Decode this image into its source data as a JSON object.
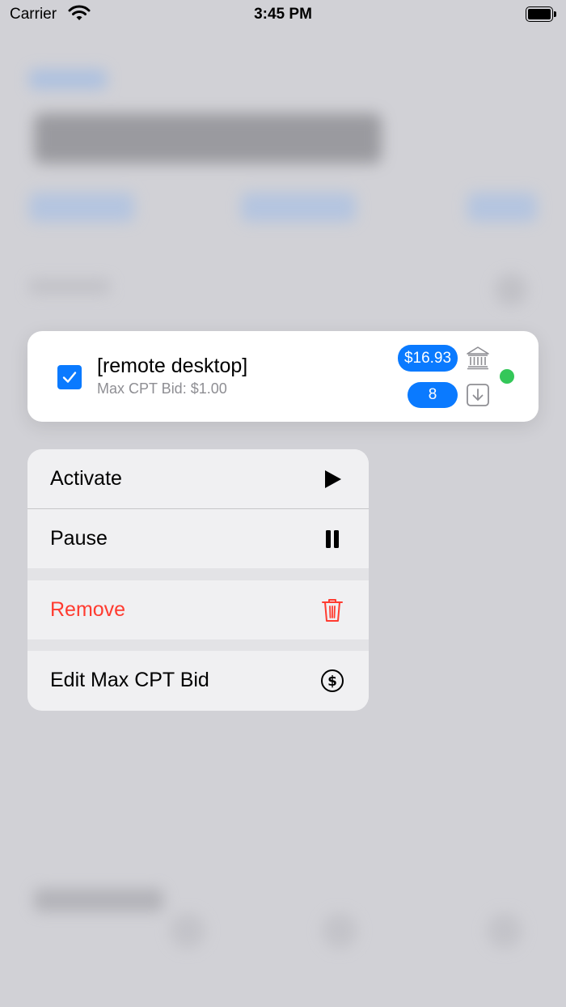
{
  "status_bar": {
    "carrier": "Carrier",
    "time": "3:45 PM",
    "icons": [
      "wifi-icon",
      "battery-icon"
    ]
  },
  "keyword_card": {
    "checked": true,
    "title": "[remote desktop]",
    "subtitle": "Max CPT Bid: $1.00",
    "spend": "$16.93",
    "installs": "8",
    "status_color": "#34c759",
    "icons": [
      "bank-icon",
      "download-icon"
    ]
  },
  "context_menu": {
    "items": [
      {
        "label": "Activate",
        "icon": "play-icon"
      },
      {
        "label": "Pause",
        "icon": "pause-icon"
      },
      {
        "label": "Remove",
        "icon": "trash-icon",
        "color": "#ff3b30"
      },
      {
        "label": "Edit Max CPT Bid",
        "icon": "dollar-circle-icon"
      }
    ]
  },
  "colors": {
    "accent": "#0a7aff",
    "destructive": "#ff3b30",
    "active": "#34c759",
    "backdrop": "#d1d1d6"
  }
}
